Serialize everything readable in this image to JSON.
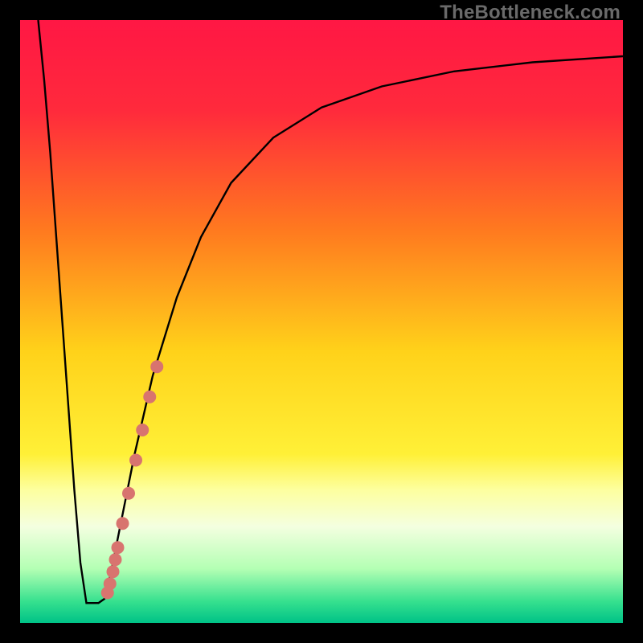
{
  "watermark": "TheBottleneck.com",
  "chart_data": {
    "type": "line",
    "title": "",
    "xlabel": "",
    "ylabel": "",
    "xlim": [
      0,
      100
    ],
    "ylim": [
      0,
      100
    ],
    "grid": false,
    "gradient_stops": [
      {
        "offset": 0.0,
        "color": "#ff1744"
      },
      {
        "offset": 0.15,
        "color": "#ff2a3c"
      },
      {
        "offset": 0.35,
        "color": "#ff7a1f"
      },
      {
        "offset": 0.55,
        "color": "#ffd21a"
      },
      {
        "offset": 0.72,
        "color": "#fff037"
      },
      {
        "offset": 0.78,
        "color": "#fdffa0"
      },
      {
        "offset": 0.84,
        "color": "#f4ffe0"
      },
      {
        "offset": 0.91,
        "color": "#b4ffb4"
      },
      {
        "offset": 0.965,
        "color": "#35e08e"
      },
      {
        "offset": 1.0,
        "color": "#00c287"
      }
    ],
    "curve": [
      {
        "x": 3.0,
        "y": 100.0
      },
      {
        "x": 4.0,
        "y": 90.0
      },
      {
        "x": 5.0,
        "y": 78.0
      },
      {
        "x": 6.0,
        "y": 64.0
      },
      {
        "x": 7.0,
        "y": 50.0
      },
      {
        "x": 8.0,
        "y": 36.0
      },
      {
        "x": 9.0,
        "y": 22.0
      },
      {
        "x": 10.0,
        "y": 10.0
      },
      {
        "x": 11.0,
        "y": 3.3
      },
      {
        "x": 12.0,
        "y": 3.3
      },
      {
        "x": 13.0,
        "y": 3.3
      },
      {
        "x": 14.0,
        "y": 4.0
      },
      {
        "x": 15.0,
        "y": 8.0
      },
      {
        "x": 17.0,
        "y": 18.0
      },
      {
        "x": 19.0,
        "y": 28.0
      },
      {
        "x": 22.0,
        "y": 41.0
      },
      {
        "x": 26.0,
        "y": 54.0
      },
      {
        "x": 30.0,
        "y": 64.0
      },
      {
        "x": 35.0,
        "y": 73.0
      },
      {
        "x": 42.0,
        "y": 80.5
      },
      {
        "x": 50.0,
        "y": 85.5
      },
      {
        "x": 60.0,
        "y": 89.0
      },
      {
        "x": 72.0,
        "y": 91.5
      },
      {
        "x": 85.0,
        "y": 93.0
      },
      {
        "x": 100.0,
        "y": 94.0
      }
    ],
    "markers": [
      {
        "x": 14.5,
        "y": 5.0
      },
      {
        "x": 14.9,
        "y": 6.5
      },
      {
        "x": 15.4,
        "y": 8.5
      },
      {
        "x": 15.8,
        "y": 10.5
      },
      {
        "x": 16.2,
        "y": 12.5
      },
      {
        "x": 17.0,
        "y": 16.5
      },
      {
        "x": 18.0,
        "y": 21.5
      },
      {
        "x": 19.2,
        "y": 27.0
      },
      {
        "x": 20.3,
        "y": 32.0
      },
      {
        "x": 21.5,
        "y": 37.5
      },
      {
        "x": 22.7,
        "y": 42.5
      }
    ],
    "marker_color": "#d8746f",
    "curve_color": "#000000"
  }
}
